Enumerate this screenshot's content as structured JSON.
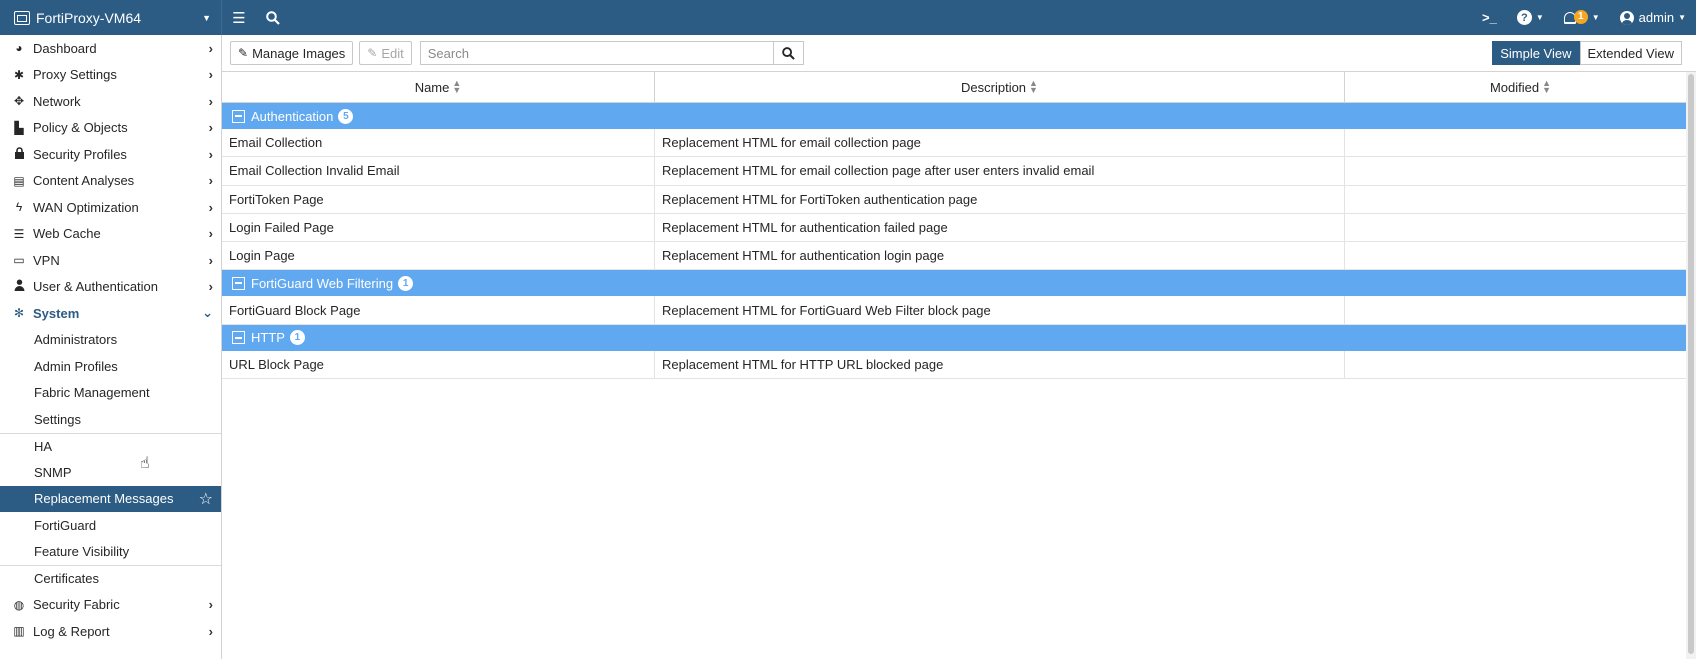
{
  "app": {
    "device_name": "FortiProxy-VM64",
    "user": "admin",
    "notification_count": "1"
  },
  "sidebar": {
    "items": [
      {
        "label": "Dashboard",
        "icon": "dashboard-icon",
        "glyph": "◕"
      },
      {
        "label": "Proxy Settings",
        "icon": "proxy-gear-icon",
        "glyph": "✱"
      },
      {
        "label": "Network",
        "icon": "network-arrows-icon",
        "glyph": "✥"
      },
      {
        "label": "Policy & Objects",
        "icon": "policy-icon",
        "glyph": "▙"
      },
      {
        "label": "Security Profiles",
        "icon": "lock-icon",
        "glyph": "🔒"
      },
      {
        "label": "Content Analyses",
        "icon": "content-analyses-icon",
        "glyph": "▤"
      },
      {
        "label": "WAN Optimization",
        "icon": "bolt-icon",
        "glyph": "ϟ"
      },
      {
        "label": "Web Cache",
        "icon": "database-icon",
        "glyph": "☰"
      },
      {
        "label": "VPN",
        "icon": "laptop-icon",
        "glyph": "▭"
      },
      {
        "label": "User & Authentication",
        "icon": "user-icon",
        "glyph": "●"
      }
    ],
    "system": {
      "label": "System",
      "icon": "gear-icon",
      "glyph": "✻"
    },
    "system_subitems": [
      "Administrators",
      "Admin Profiles",
      "Fabric Management",
      "Settings",
      "HA",
      "SNMP",
      "Replacement Messages",
      "FortiGuard",
      "Feature Visibility",
      "Certificates"
    ],
    "bottom_items": [
      {
        "label": "Security Fabric",
        "icon": "security-fabric-icon",
        "glyph": "◍"
      },
      {
        "label": "Log & Report",
        "icon": "bar-chart-icon",
        "glyph": "▥"
      }
    ]
  },
  "toolbar": {
    "manage_images": "Manage Images",
    "edit": "Edit",
    "search_placeholder": "Search",
    "simple_view": "Simple View",
    "extended_view": "Extended View"
  },
  "table": {
    "columns": [
      "Name",
      "Description",
      "Modified"
    ],
    "groups": [
      {
        "name": "Authentication",
        "count": "5",
        "rows": [
          {
            "name": "Email Collection",
            "description": "Replacement HTML for email collection page",
            "modified": ""
          },
          {
            "name": "Email Collection Invalid Email",
            "description": "Replacement HTML for email collection page after user enters invalid email",
            "modified": ""
          },
          {
            "name": "FortiToken Page",
            "description": "Replacement HTML for FortiToken authentication page",
            "modified": ""
          },
          {
            "name": "Login Failed Page",
            "description": "Replacement HTML for authentication failed page",
            "modified": ""
          },
          {
            "name": "Login Page",
            "description": "Replacement HTML for authentication login page",
            "modified": ""
          }
        ]
      },
      {
        "name": "FortiGuard Web Filtering",
        "count": "1",
        "rows": [
          {
            "name": "FortiGuard Block Page",
            "description": "Replacement HTML for FortiGuard Web Filter block page",
            "modified": ""
          }
        ]
      },
      {
        "name": "HTTP",
        "count": "1",
        "rows": [
          {
            "name": "URL Block Page",
            "description": "Replacement HTML for HTTP URL blocked page",
            "modified": ""
          }
        ]
      }
    ]
  },
  "colors": {
    "topbar": "#2c5b84",
    "group_row": "#60a8f0",
    "notification_badge": "#f5a623"
  }
}
